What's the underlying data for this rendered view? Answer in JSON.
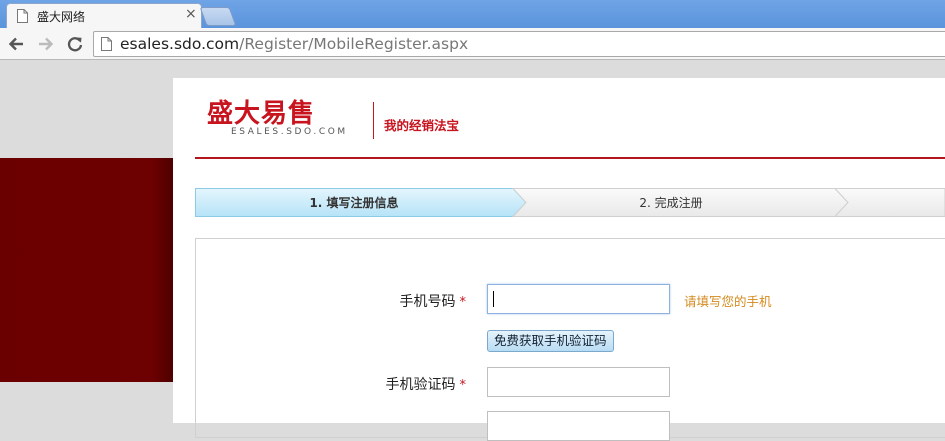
{
  "browser": {
    "tab_title": "盛大网络",
    "url_host": "esales.sdo.com",
    "url_path": "/Register/MobileRegister.aspx"
  },
  "header": {
    "logo_cn": "盛大易售",
    "logo_en": "ESALES.SDO.COM",
    "slogan": "我的经销法宝"
  },
  "steps": [
    {
      "label": "1. 填写注册信息",
      "active": true
    },
    {
      "label": "2. 完成注册",
      "active": false
    }
  ],
  "form": {
    "phone_label": "手机号码",
    "phone_value": "",
    "phone_hint": "请填写您的手机",
    "sms_button": "免费获取手机验证码",
    "code_label": "手机验证码",
    "code_value": "",
    "required_mark": "*"
  },
  "colors": {
    "brand_red": "#c8141e",
    "step_active": "#c9ecfa",
    "hint": "#d58a1c"
  }
}
